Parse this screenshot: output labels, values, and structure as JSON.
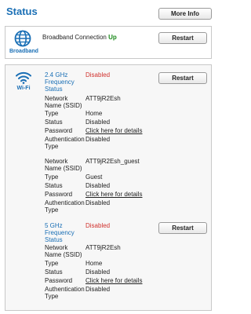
{
  "header": {
    "title": "Status",
    "more_info": "More Info"
  },
  "broadband": {
    "icon_label": "Broadband",
    "text": "Broadband Connection",
    "state": "Up",
    "restart": "Restart"
  },
  "wifi": {
    "icon_label": "Wi-Fi",
    "band24": {
      "title": "2.4 GHz Frequency Status",
      "state": "Disabled",
      "restart": "Restart",
      "net1": {
        "network_name_label": "Network Name (SSID)",
        "network_name": "ATT9jR2Esh",
        "type_label": "Type",
        "type": "Home",
        "status_label": "Status",
        "status": "Disabled",
        "password_label": "Password",
        "password": "Click here for details",
        "auth_label": "Authentication Type",
        "auth": "Disabled"
      },
      "net2": {
        "network_name_label": "Network Name (SSID)",
        "network_name": "ATT9jR2Esh_guest",
        "type_label": "Type",
        "type": "Guest",
        "status_label": "Status",
        "status": "Disabled",
        "password_label": "Password",
        "password": "Click here for details",
        "auth_label": "Authentication Type",
        "auth": "Disabled"
      }
    },
    "band5": {
      "title": "5 GHz Frequency Status",
      "state": "Disabled",
      "restart": "Restart",
      "net1": {
        "network_name_label": "Network Name (SSID)",
        "network_name": "ATT9jR2Esh",
        "type_label": "Type",
        "type": "Home",
        "status_label": "Status",
        "status": "Disabled",
        "password_label": "Password",
        "password": "Click here for details",
        "auth_label": "Authentication Type",
        "auth": "Disabled"
      }
    }
  },
  "colors": {
    "accent": "#1a6fb5",
    "up": "#1a8a1a",
    "disabled": "#d0312d"
  }
}
